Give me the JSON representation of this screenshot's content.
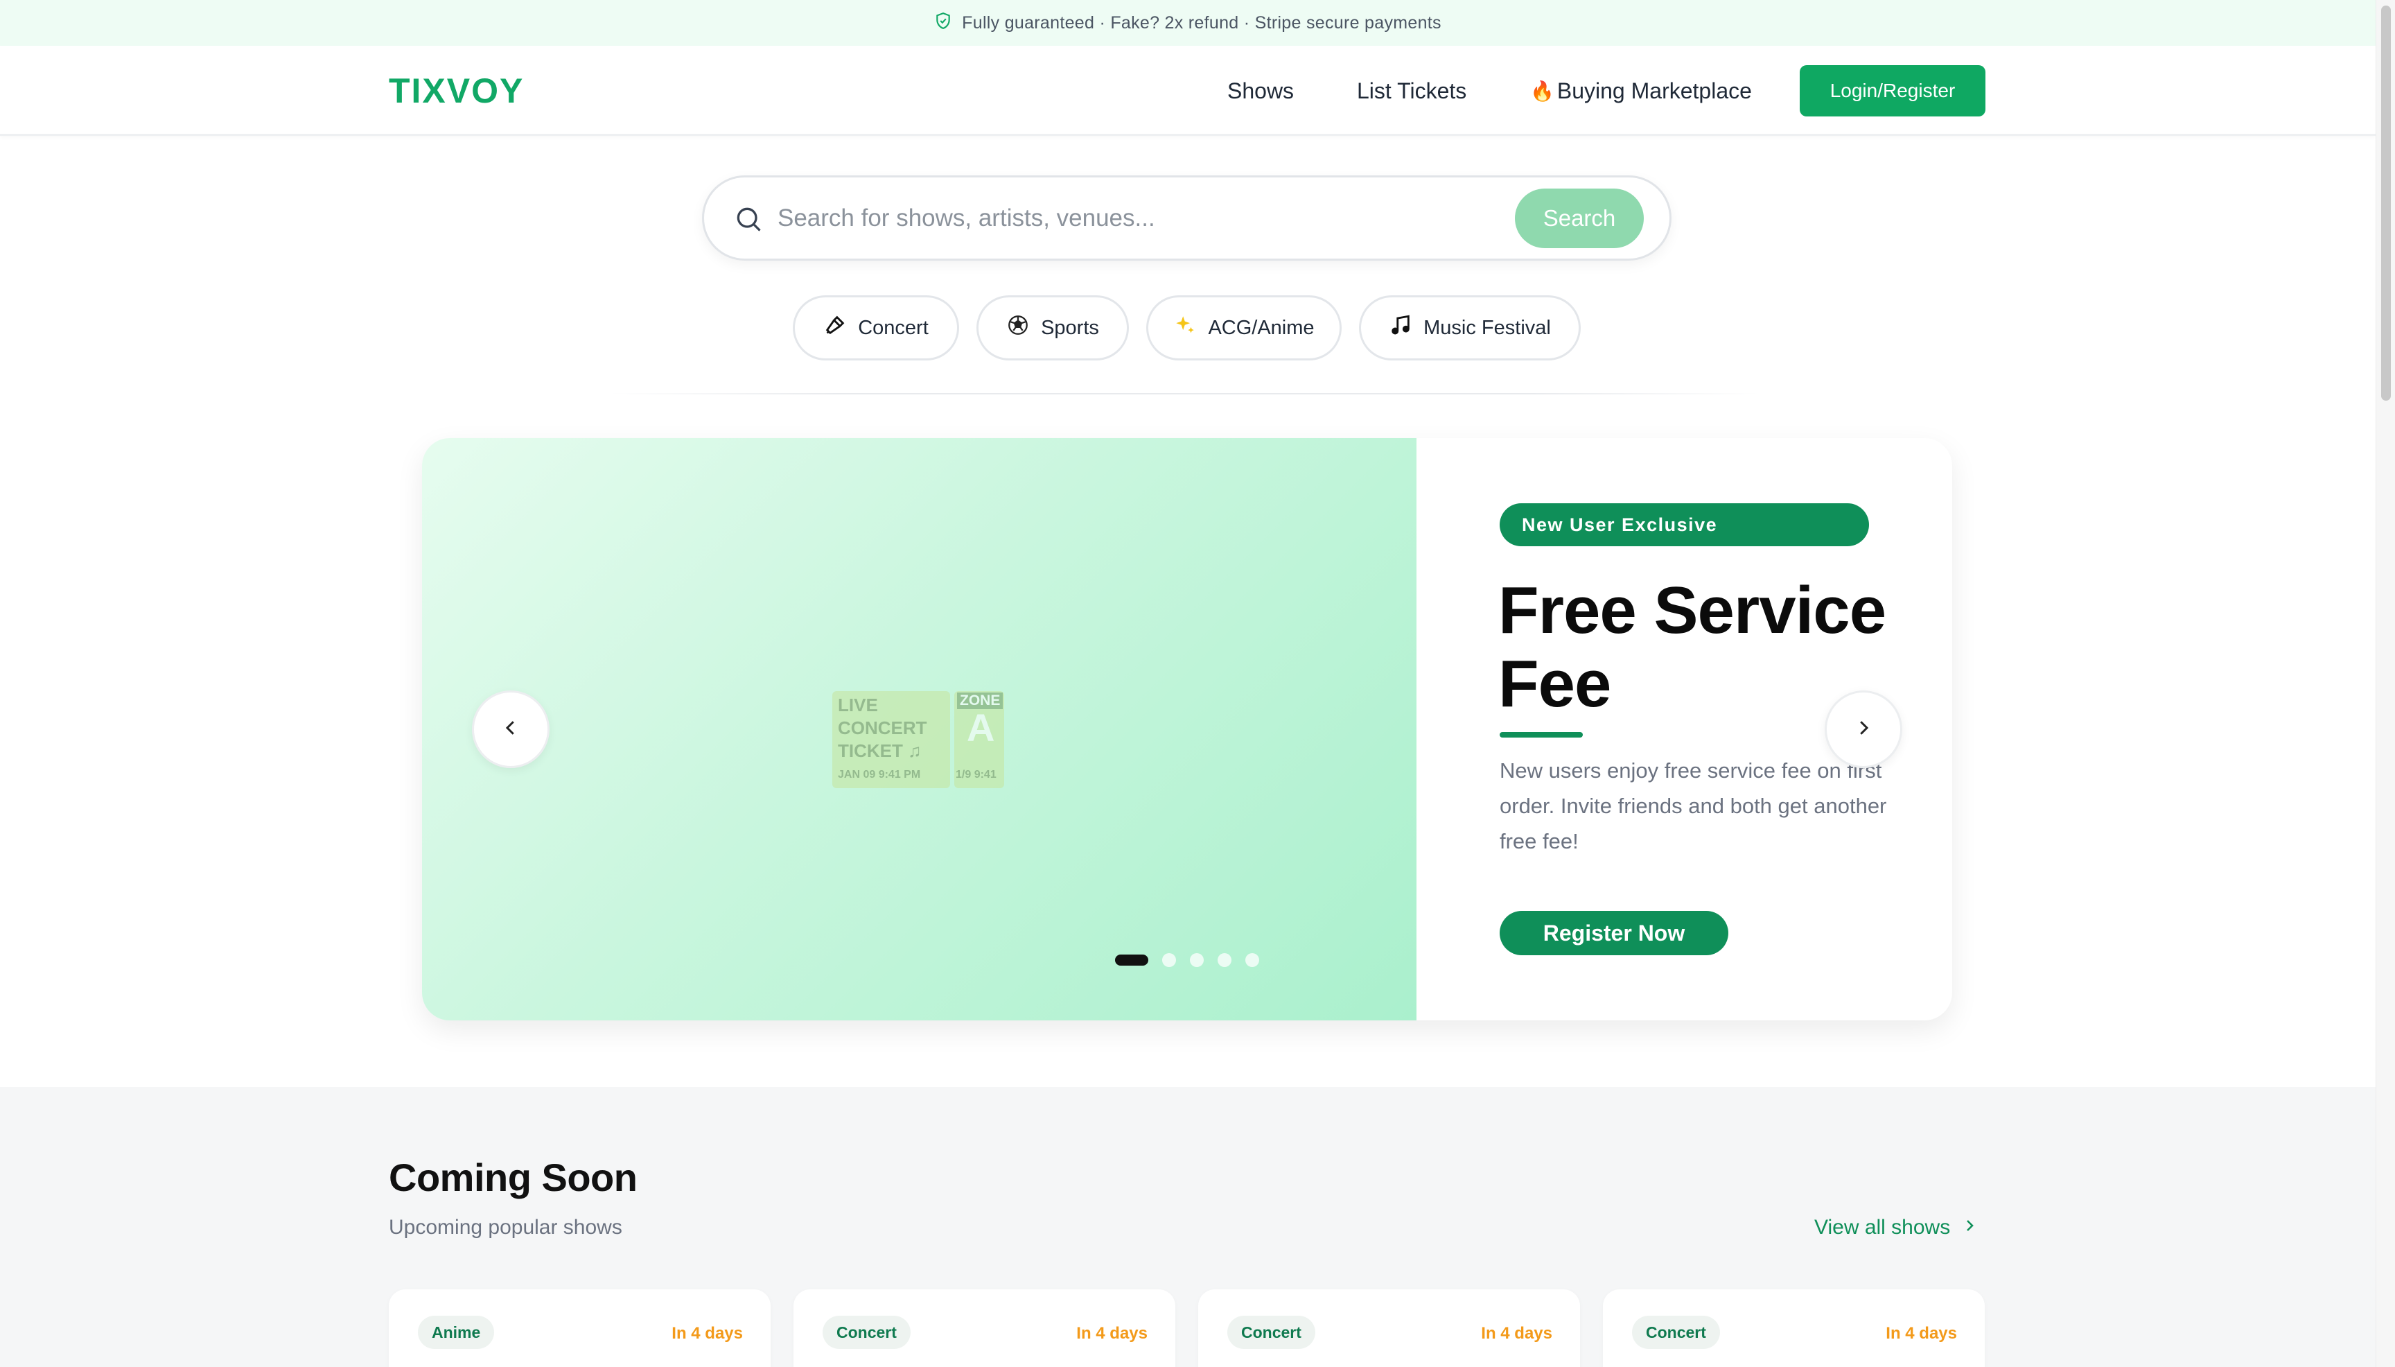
{
  "banner": {
    "text": "Fully guaranteed · Fake? 2x refund · Stripe secure payments",
    "icon": "shield-check-icon"
  },
  "header": {
    "logo": "TIXVOY",
    "nav": {
      "shows": "Shows",
      "list_tickets": "List Tickets",
      "buying_marketplace": "Buying Marketplace"
    },
    "login_label": "Login/Register"
  },
  "search": {
    "placeholder": "Search for shows, artists, venues...",
    "value": "",
    "button_label": "Search"
  },
  "categories": [
    {
      "label": "Concert",
      "icon": "microphone-icon"
    },
    {
      "label": "Sports",
      "icon": "soccer-ball-icon"
    },
    {
      "label": "ACG/Anime",
      "icon": "sparkles-icon"
    },
    {
      "label": "Music Festival",
      "icon": "music-note-icon"
    }
  ],
  "hero": {
    "ticket": {
      "line1": "LIVE",
      "line2": "CONCERT",
      "line3": "TICKET ♫",
      "date": "JAN 09   9:41 PM",
      "zone_label": "ZONE",
      "zone": "A",
      "stub_time": "1/9   9:41"
    },
    "badge": "New User Exclusive",
    "title": "Free Service Fee",
    "description": "New users enjoy free service fee on first order. Invite friends and both get another free fee!",
    "cta_label": "Register Now",
    "slide_count": 5,
    "active_slide": 1
  },
  "coming_soon": {
    "title": "Coming Soon",
    "subtitle": "Upcoming popular shows",
    "view_all_label": "View all shows",
    "cards": [
      {
        "tag": "Anime",
        "when": "In 4 days"
      },
      {
        "tag": "Concert",
        "when": "In 4 days"
      },
      {
        "tag": "Concert",
        "when": "In 4 days"
      },
      {
        "tag": "Concert",
        "when": "In 4 days"
      }
    ]
  },
  "colors": {
    "brand_green": "#11a866",
    "dark_green": "#0f8f59",
    "banner_bg": "#eefcf4",
    "accent_orange": "#f39a1a"
  }
}
